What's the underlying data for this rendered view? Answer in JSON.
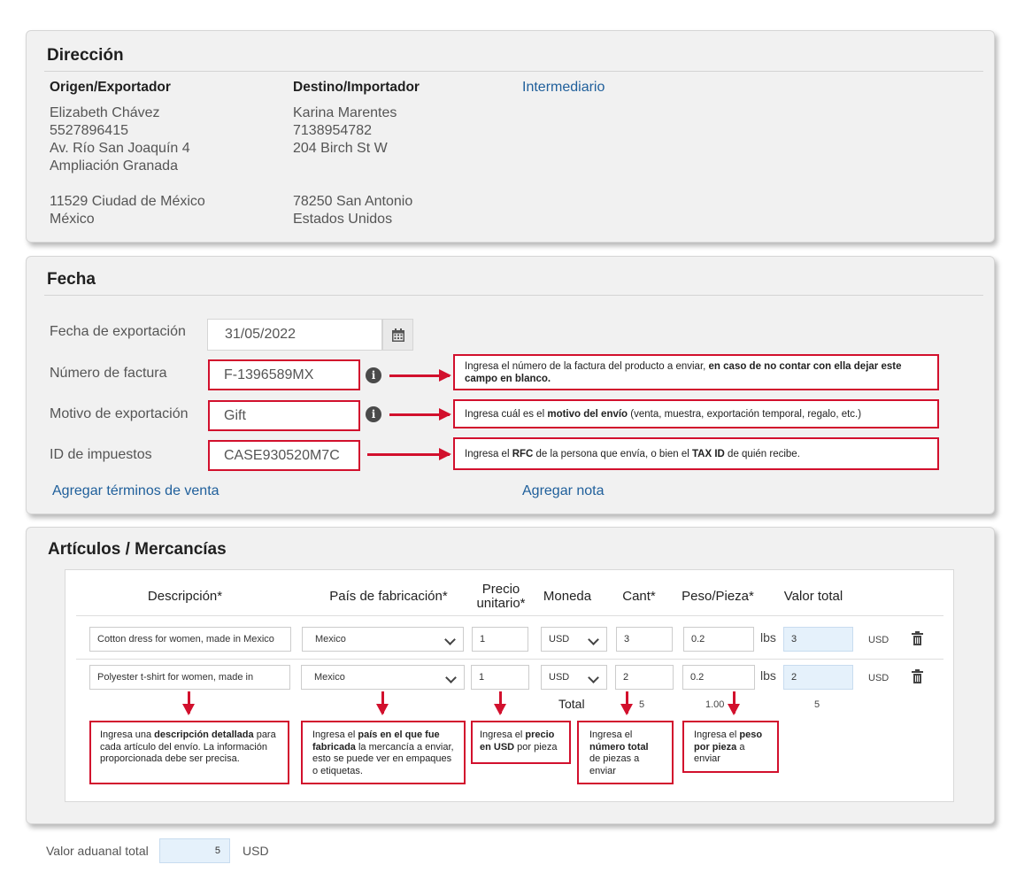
{
  "direccion": {
    "title": "Dirección",
    "origen": {
      "heading": "Origen/Exportador",
      "name": "Elizabeth Chávez",
      "phone": "5527896415",
      "street": "Av. Río San Joaquín 4",
      "area": "Ampliación Granada",
      "zip_city": "11529 Ciudad de México",
      "country": "México"
    },
    "destino": {
      "heading": "Destino/Importador",
      "name": "Karina Marentes",
      "phone": "7138954782",
      "street": "204 Birch St W",
      "zip_city": "78250 San Antonio",
      "country": "Estados Unidos"
    },
    "intermediario_link": "Intermediario"
  },
  "fecha": {
    "title": "Fecha",
    "export_date_label": "Fecha de exportación",
    "export_date_value": "31/05/2022",
    "invoice_label": "Número de factura",
    "invoice_value": "F-1396589MX",
    "reason_label": "Motivo de exportación",
    "reason_value": "Gift",
    "tax_label": "ID de impuestos",
    "tax_value": "CASE930520M7C",
    "add_terms_link": "Agregar términos de venta",
    "add_note_link": "Agregar nota",
    "tips": {
      "invoice_a": "Ingresa el número de la factura del producto a enviar, ",
      "invoice_b": "en caso de no contar con ella dejar este campo en blanco.",
      "reason_a": "Ingresa cuál es el ",
      "reason_b": "motivo del envío",
      "reason_c": " (venta, muestra, exportación temporal, regalo, etc.)",
      "tax_a": "Ingresa el ",
      "tax_b": "RFC",
      "tax_c": " de la persona que envía, o bien el ",
      "tax_d": "TAX ID",
      "tax_e": " de quién recibe."
    }
  },
  "articulos": {
    "title": "Artículos / Mercancías",
    "headers": {
      "descripcion": "Descripción*",
      "pais": "País de fabricación*",
      "precio_1": "Precio",
      "precio_2": "unitario*",
      "moneda": "Moneda",
      "cant": "Cant*",
      "peso": "Peso/Pieza*",
      "valor": "Valor total"
    },
    "rows": [
      {
        "descripcion": "Cotton dress for women, made in Mexico",
        "pais": "Mexico",
        "precio": "1",
        "moneda": "USD",
        "cant": "3",
        "peso": "0.2",
        "peso_unit": "lbs",
        "valor": "3",
        "valor_unit": "USD"
      },
      {
        "descripcion": "Polyester t-shirt for women, made in",
        "pais": "Mexico",
        "precio": "1",
        "moneda": "USD",
        "cant": "2",
        "peso": "0.2",
        "peso_unit": "lbs",
        "valor": "2",
        "valor_unit": "USD"
      }
    ],
    "totals": {
      "label": "Total",
      "cant": "5",
      "peso": "1.00",
      "valor": "5"
    },
    "tips": {
      "desc_a": "Ingresa una ",
      "desc_b": "descripción detallada",
      "desc_c": " para cada artículo del envío. La información proporcionada debe ser precisa.",
      "pais_a": "Ingresa el ",
      "pais_b": "país en el que fue fabricada",
      "pais_c": " la mercancía a enviar, esto se puede ver en empaques o etiquetas.",
      "precio_a": "Ingresa el ",
      "precio_b": "precio en USD",
      "precio_c": " por pieza",
      "cant_a": "Ingresa el ",
      "cant_b": "número total",
      "cant_c": " de piezas a enviar",
      "peso_a": "Ingresa el ",
      "peso_b": "peso por pieza",
      "peso_c": " a enviar"
    }
  },
  "footer": {
    "label": "Valor aduanal total",
    "value": "5",
    "currency": "USD"
  },
  "colors": {
    "annotation_red": "#d2102d",
    "link_blue": "#1f5f9b",
    "total_field_blue": "#e5f1fb"
  },
  "icons": [
    "calendar-icon",
    "info-icon",
    "chevron-down-icon",
    "trash-icon"
  ]
}
